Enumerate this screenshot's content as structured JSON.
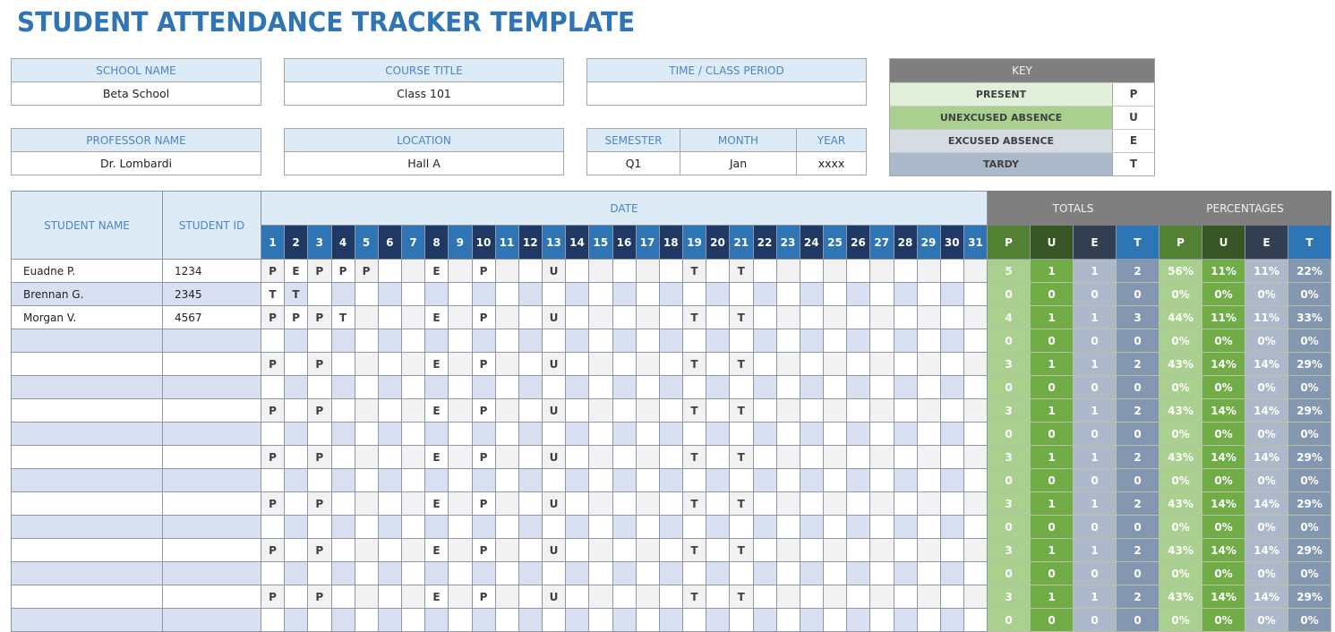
{
  "title": "STUDENT ATTENDANCE TRACKER TEMPLATE",
  "info": {
    "school_name": {
      "label": "SCHOOL NAME",
      "value": "Beta School"
    },
    "course_title": {
      "label": "COURSE TITLE",
      "value": "Class 101"
    },
    "time_class_period": {
      "label": "TIME / CLASS PERIOD",
      "value": ""
    },
    "professor_name": {
      "label": "PROFESSOR NAME",
      "value": "Dr. Lombardi"
    },
    "location": {
      "label": "LOCATION",
      "value": "Hall A"
    },
    "semester": {
      "label": "SEMESTER",
      "value": "Q1"
    },
    "month": {
      "label": "MONTH",
      "value": "Jan"
    },
    "year": {
      "label": "YEAR",
      "value": "xxxx"
    }
  },
  "key": {
    "title": "KEY",
    "items": [
      {
        "label": "PRESENT",
        "code": "P",
        "color": "#e2efda"
      },
      {
        "label": "UNEXCUSED ABSENCE",
        "code": "U",
        "color": "#a9d08e"
      },
      {
        "label": "EXCUSED ABSENCE",
        "code": "E",
        "color": "#d6dce4"
      },
      {
        "label": "TARDY",
        "code": "T",
        "color": "#acb9ca"
      }
    ]
  },
  "table": {
    "student_name_header": "STUDENT NAME",
    "student_id_header": "STUDENT ID",
    "date_header": "DATE",
    "totals_header": "TOTALS",
    "percentages_header": "PERCENTAGES",
    "days": [
      "1",
      "2",
      "3",
      "4",
      "5",
      "6",
      "7",
      "8",
      "9",
      "10",
      "11",
      "12",
      "13",
      "14",
      "15",
      "16",
      "17",
      "18",
      "19",
      "20",
      "21",
      "22",
      "23",
      "24",
      "25",
      "26",
      "27",
      "28",
      "29",
      "30",
      "31"
    ],
    "total_cols": [
      "P",
      "U",
      "E",
      "T"
    ],
    "pct_cols": [
      "P",
      "U",
      "E",
      "T"
    ],
    "rows": [
      {
        "name": "Euadne P.",
        "id": "1234",
        "marks": {
          "1": "P",
          "2": "E",
          "3": "P",
          "4": "P",
          "5": "P",
          "8": "E",
          "10": "P",
          "13": "U",
          "19": "T",
          "21": "T"
        },
        "totals": [
          "5",
          "1",
          "1",
          "2"
        ],
        "pcts": [
          "56%",
          "11%",
          "11%",
          "22%"
        ]
      },
      {
        "name": "Brennan G.",
        "id": "2345",
        "marks": {
          "1": "T",
          "2": "T"
        },
        "totals": [
          "0",
          "0",
          "0",
          "0"
        ],
        "pcts": [
          "0%",
          "0%",
          "0%",
          "0%"
        ]
      },
      {
        "name": "Morgan V.",
        "id": "4567",
        "marks": {
          "1": "P",
          "2": "P",
          "3": "P",
          "4": "T",
          "8": "E",
          "10": "P",
          "13": "U",
          "19": "T",
          "21": "T"
        },
        "totals": [
          "4",
          "1",
          "1",
          "3"
        ],
        "pcts": [
          "44%",
          "11%",
          "11%",
          "33%"
        ]
      },
      {
        "name": "",
        "id": "",
        "marks": {},
        "totals": [
          "0",
          "0",
          "0",
          "0"
        ],
        "pcts": [
          "0%",
          "0%",
          "0%",
          "0%"
        ]
      },
      {
        "name": "",
        "id": "",
        "marks": {
          "1": "P",
          "3": "P",
          "8": "E",
          "10": "P",
          "13": "U",
          "19": "T",
          "21": "T"
        },
        "totals": [
          "3",
          "1",
          "1",
          "2"
        ],
        "pcts": [
          "43%",
          "14%",
          "14%",
          "29%"
        ]
      },
      {
        "name": "",
        "id": "",
        "marks": {},
        "totals": [
          "0",
          "0",
          "0",
          "0"
        ],
        "pcts": [
          "0%",
          "0%",
          "0%",
          "0%"
        ]
      },
      {
        "name": "",
        "id": "",
        "marks": {
          "1": "P",
          "3": "P",
          "8": "E",
          "10": "P",
          "13": "U",
          "19": "T",
          "21": "T"
        },
        "totals": [
          "3",
          "1",
          "1",
          "2"
        ],
        "pcts": [
          "43%",
          "14%",
          "14%",
          "29%"
        ]
      },
      {
        "name": "",
        "id": "",
        "marks": {},
        "totals": [
          "0",
          "0",
          "0",
          "0"
        ],
        "pcts": [
          "0%",
          "0%",
          "0%",
          "0%"
        ]
      },
      {
        "name": "",
        "id": "",
        "marks": {
          "1": "P",
          "3": "P",
          "8": "E",
          "10": "P",
          "13": "U",
          "19": "T",
          "21": "T"
        },
        "totals": [
          "3",
          "1",
          "1",
          "2"
        ],
        "pcts": [
          "43%",
          "14%",
          "14%",
          "29%"
        ]
      },
      {
        "name": "",
        "id": "",
        "marks": {},
        "totals": [
          "0",
          "0",
          "0",
          "0"
        ],
        "pcts": [
          "0%",
          "0%",
          "0%",
          "0%"
        ]
      },
      {
        "name": "",
        "id": "",
        "marks": {
          "1": "P",
          "3": "P",
          "8": "E",
          "10": "P",
          "13": "U",
          "19": "T",
          "21": "T"
        },
        "totals": [
          "3",
          "1",
          "1",
          "2"
        ],
        "pcts": [
          "43%",
          "14%",
          "14%",
          "29%"
        ]
      },
      {
        "name": "",
        "id": "",
        "marks": {},
        "totals": [
          "0",
          "0",
          "0",
          "0"
        ],
        "pcts": [
          "0%",
          "0%",
          "0%",
          "0%"
        ]
      },
      {
        "name": "",
        "id": "",
        "marks": {
          "1": "P",
          "3": "P",
          "8": "E",
          "10": "P",
          "13": "U",
          "19": "T",
          "21": "T"
        },
        "totals": [
          "3",
          "1",
          "1",
          "2"
        ],
        "pcts": [
          "43%",
          "14%",
          "14%",
          "29%"
        ]
      },
      {
        "name": "",
        "id": "",
        "marks": {},
        "totals": [
          "0",
          "0",
          "0",
          "0"
        ],
        "pcts": [
          "0%",
          "0%",
          "0%",
          "0%"
        ]
      },
      {
        "name": "",
        "id": "",
        "marks": {
          "1": "P",
          "3": "P",
          "8": "E",
          "10": "P",
          "13": "U",
          "19": "T",
          "21": "T"
        },
        "totals": [
          "3",
          "1",
          "1",
          "2"
        ],
        "pcts": [
          "43%",
          "14%",
          "14%",
          "29%"
        ]
      },
      {
        "name": "",
        "id": "",
        "marks": {},
        "totals": [
          "0",
          "0",
          "0",
          "0"
        ],
        "pcts": [
          "0%",
          "0%",
          "0%",
          "0%"
        ]
      }
    ]
  }
}
